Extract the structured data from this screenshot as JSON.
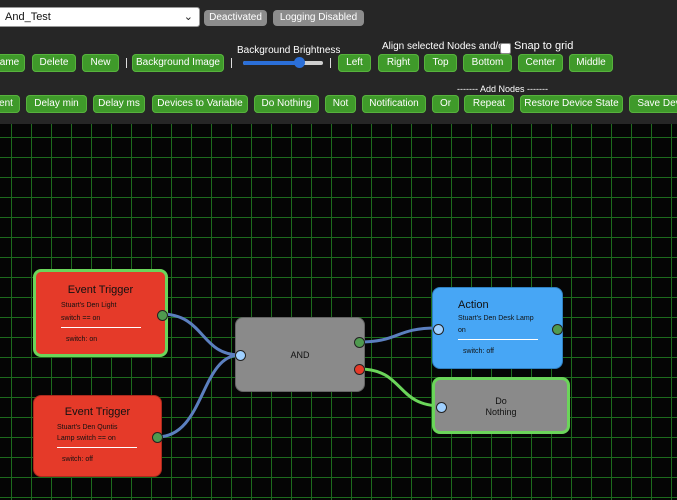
{
  "toolbar": {
    "rule_select_value": "And_Test",
    "status_deactivated": "Deactivated",
    "status_logging": "Logging Disabled",
    "row1": {
      "rename_label": "ame",
      "delete_label": "Delete",
      "new_label": "New",
      "background_image_label": "Background Image",
      "brightness_label": "Background Brightness",
      "brightness_value": 0.7,
      "align_label": "Align selected Nodes and/or",
      "snap_label": "Snap to grid",
      "align_buttons": [
        "Left",
        "Right",
        "Top",
        "Bottom",
        "Center",
        "Middle"
      ]
    },
    "add_nodes_label": "------- Add Nodes -------",
    "row2_buttons": [
      "ent",
      "Delay min",
      "Delay ms",
      "Devices to Variable",
      "Do Nothing",
      "Not",
      "Notification",
      "Or",
      "Repeat",
      "Restore Device State",
      "Save Dev"
    ]
  },
  "nodes": {
    "trigger1": {
      "title": "Event Trigger",
      "line1": "Stuart's Den Light",
      "line2": "switch == on",
      "line3": "switch: on"
    },
    "trigger2": {
      "title": "Event Trigger",
      "line1": "Stuart's Den Quntis",
      "line2": "Lamp switch == on",
      "line3": "switch: off"
    },
    "and": {
      "title": "AND"
    },
    "action": {
      "title": "Action",
      "line1": "Stuart's Den Desk Lamp",
      "line2": "on",
      "line3": "switch: off"
    },
    "donothing": {
      "title_line1": "Do",
      "title_line2": "Nothing"
    }
  },
  "colors": {
    "button_green": "#3f9a2a",
    "trigger_red": "#e53a29",
    "node_gray": "#8a8a8a",
    "action_blue": "#47a6f5",
    "active_border": "#6bd55a",
    "grid": "#1d6b1d"
  }
}
